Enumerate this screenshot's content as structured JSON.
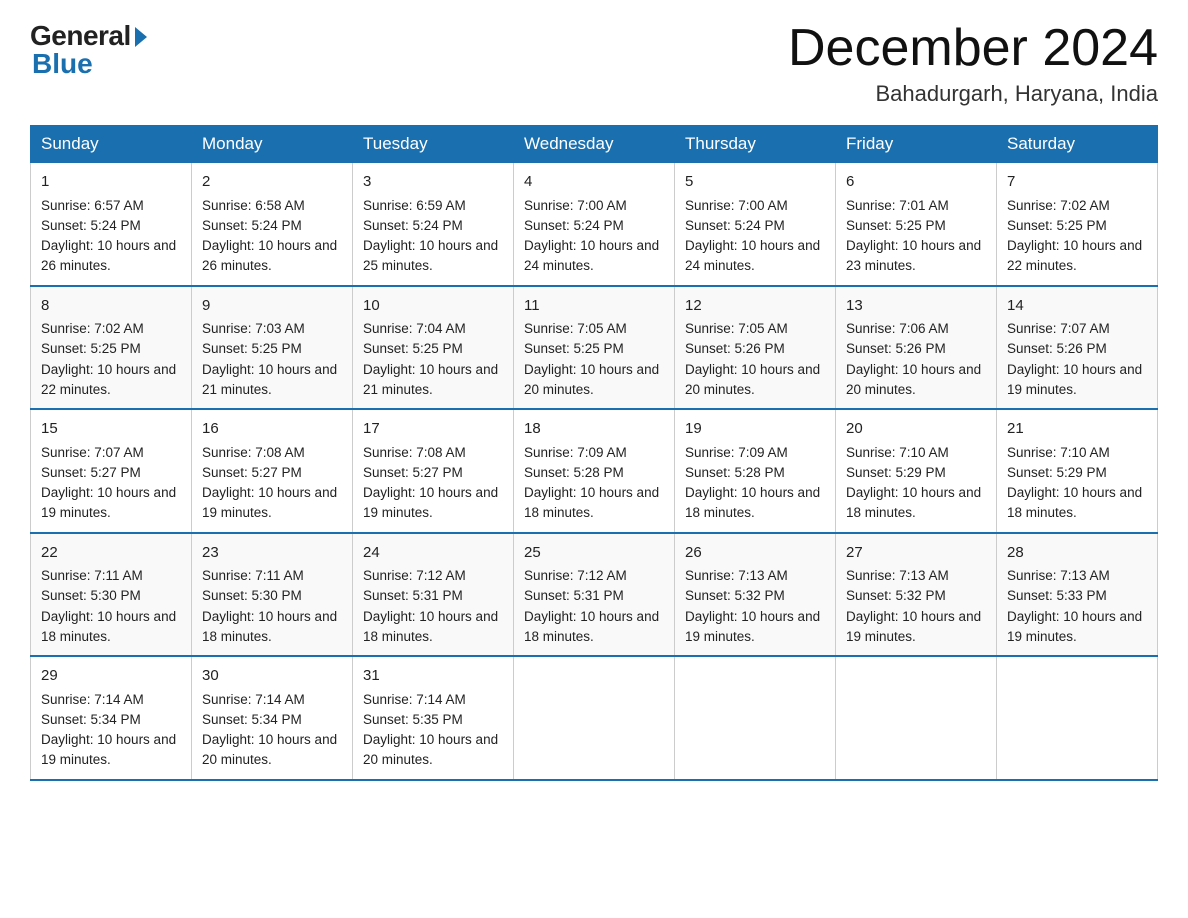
{
  "header": {
    "logo_general": "General",
    "logo_blue": "Blue",
    "month_title": "December 2024",
    "location": "Bahadurgarh, Haryana, India"
  },
  "days_of_week": [
    "Sunday",
    "Monday",
    "Tuesday",
    "Wednesday",
    "Thursday",
    "Friday",
    "Saturday"
  ],
  "weeks": [
    [
      {
        "day": "1",
        "sunrise": "6:57 AM",
        "sunset": "5:24 PM",
        "daylight": "10 hours and 26 minutes."
      },
      {
        "day": "2",
        "sunrise": "6:58 AM",
        "sunset": "5:24 PM",
        "daylight": "10 hours and 26 minutes."
      },
      {
        "day": "3",
        "sunrise": "6:59 AM",
        "sunset": "5:24 PM",
        "daylight": "10 hours and 25 minutes."
      },
      {
        "day": "4",
        "sunrise": "7:00 AM",
        "sunset": "5:24 PM",
        "daylight": "10 hours and 24 minutes."
      },
      {
        "day": "5",
        "sunrise": "7:00 AM",
        "sunset": "5:24 PM",
        "daylight": "10 hours and 24 minutes."
      },
      {
        "day": "6",
        "sunrise": "7:01 AM",
        "sunset": "5:25 PM",
        "daylight": "10 hours and 23 minutes."
      },
      {
        "day": "7",
        "sunrise": "7:02 AM",
        "sunset": "5:25 PM",
        "daylight": "10 hours and 22 minutes."
      }
    ],
    [
      {
        "day": "8",
        "sunrise": "7:02 AM",
        "sunset": "5:25 PM",
        "daylight": "10 hours and 22 minutes."
      },
      {
        "day": "9",
        "sunrise": "7:03 AM",
        "sunset": "5:25 PM",
        "daylight": "10 hours and 21 minutes."
      },
      {
        "day": "10",
        "sunrise": "7:04 AM",
        "sunset": "5:25 PM",
        "daylight": "10 hours and 21 minutes."
      },
      {
        "day": "11",
        "sunrise": "7:05 AM",
        "sunset": "5:25 PM",
        "daylight": "10 hours and 20 minutes."
      },
      {
        "day": "12",
        "sunrise": "7:05 AM",
        "sunset": "5:26 PM",
        "daylight": "10 hours and 20 minutes."
      },
      {
        "day": "13",
        "sunrise": "7:06 AM",
        "sunset": "5:26 PM",
        "daylight": "10 hours and 20 minutes."
      },
      {
        "day": "14",
        "sunrise": "7:07 AM",
        "sunset": "5:26 PM",
        "daylight": "10 hours and 19 minutes."
      }
    ],
    [
      {
        "day": "15",
        "sunrise": "7:07 AM",
        "sunset": "5:27 PM",
        "daylight": "10 hours and 19 minutes."
      },
      {
        "day": "16",
        "sunrise": "7:08 AM",
        "sunset": "5:27 PM",
        "daylight": "10 hours and 19 minutes."
      },
      {
        "day": "17",
        "sunrise": "7:08 AM",
        "sunset": "5:27 PM",
        "daylight": "10 hours and 19 minutes."
      },
      {
        "day": "18",
        "sunrise": "7:09 AM",
        "sunset": "5:28 PM",
        "daylight": "10 hours and 18 minutes."
      },
      {
        "day": "19",
        "sunrise": "7:09 AM",
        "sunset": "5:28 PM",
        "daylight": "10 hours and 18 minutes."
      },
      {
        "day": "20",
        "sunrise": "7:10 AM",
        "sunset": "5:29 PM",
        "daylight": "10 hours and 18 minutes."
      },
      {
        "day": "21",
        "sunrise": "7:10 AM",
        "sunset": "5:29 PM",
        "daylight": "10 hours and 18 minutes."
      }
    ],
    [
      {
        "day": "22",
        "sunrise": "7:11 AM",
        "sunset": "5:30 PM",
        "daylight": "10 hours and 18 minutes."
      },
      {
        "day": "23",
        "sunrise": "7:11 AM",
        "sunset": "5:30 PM",
        "daylight": "10 hours and 18 minutes."
      },
      {
        "day": "24",
        "sunrise": "7:12 AM",
        "sunset": "5:31 PM",
        "daylight": "10 hours and 18 minutes."
      },
      {
        "day": "25",
        "sunrise": "7:12 AM",
        "sunset": "5:31 PM",
        "daylight": "10 hours and 18 minutes."
      },
      {
        "day": "26",
        "sunrise": "7:13 AM",
        "sunset": "5:32 PM",
        "daylight": "10 hours and 19 minutes."
      },
      {
        "day": "27",
        "sunrise": "7:13 AM",
        "sunset": "5:32 PM",
        "daylight": "10 hours and 19 minutes."
      },
      {
        "day": "28",
        "sunrise": "7:13 AM",
        "sunset": "5:33 PM",
        "daylight": "10 hours and 19 minutes."
      }
    ],
    [
      {
        "day": "29",
        "sunrise": "7:14 AM",
        "sunset": "5:34 PM",
        "daylight": "10 hours and 19 minutes."
      },
      {
        "day": "30",
        "sunrise": "7:14 AM",
        "sunset": "5:34 PM",
        "daylight": "10 hours and 20 minutes."
      },
      {
        "day": "31",
        "sunrise": "7:14 AM",
        "sunset": "5:35 PM",
        "daylight": "10 hours and 20 minutes."
      },
      {
        "day": "",
        "sunrise": "",
        "sunset": "",
        "daylight": ""
      },
      {
        "day": "",
        "sunrise": "",
        "sunset": "",
        "daylight": ""
      },
      {
        "day": "",
        "sunrise": "",
        "sunset": "",
        "daylight": ""
      },
      {
        "day": "",
        "sunrise": "",
        "sunset": "",
        "daylight": ""
      }
    ]
  ]
}
